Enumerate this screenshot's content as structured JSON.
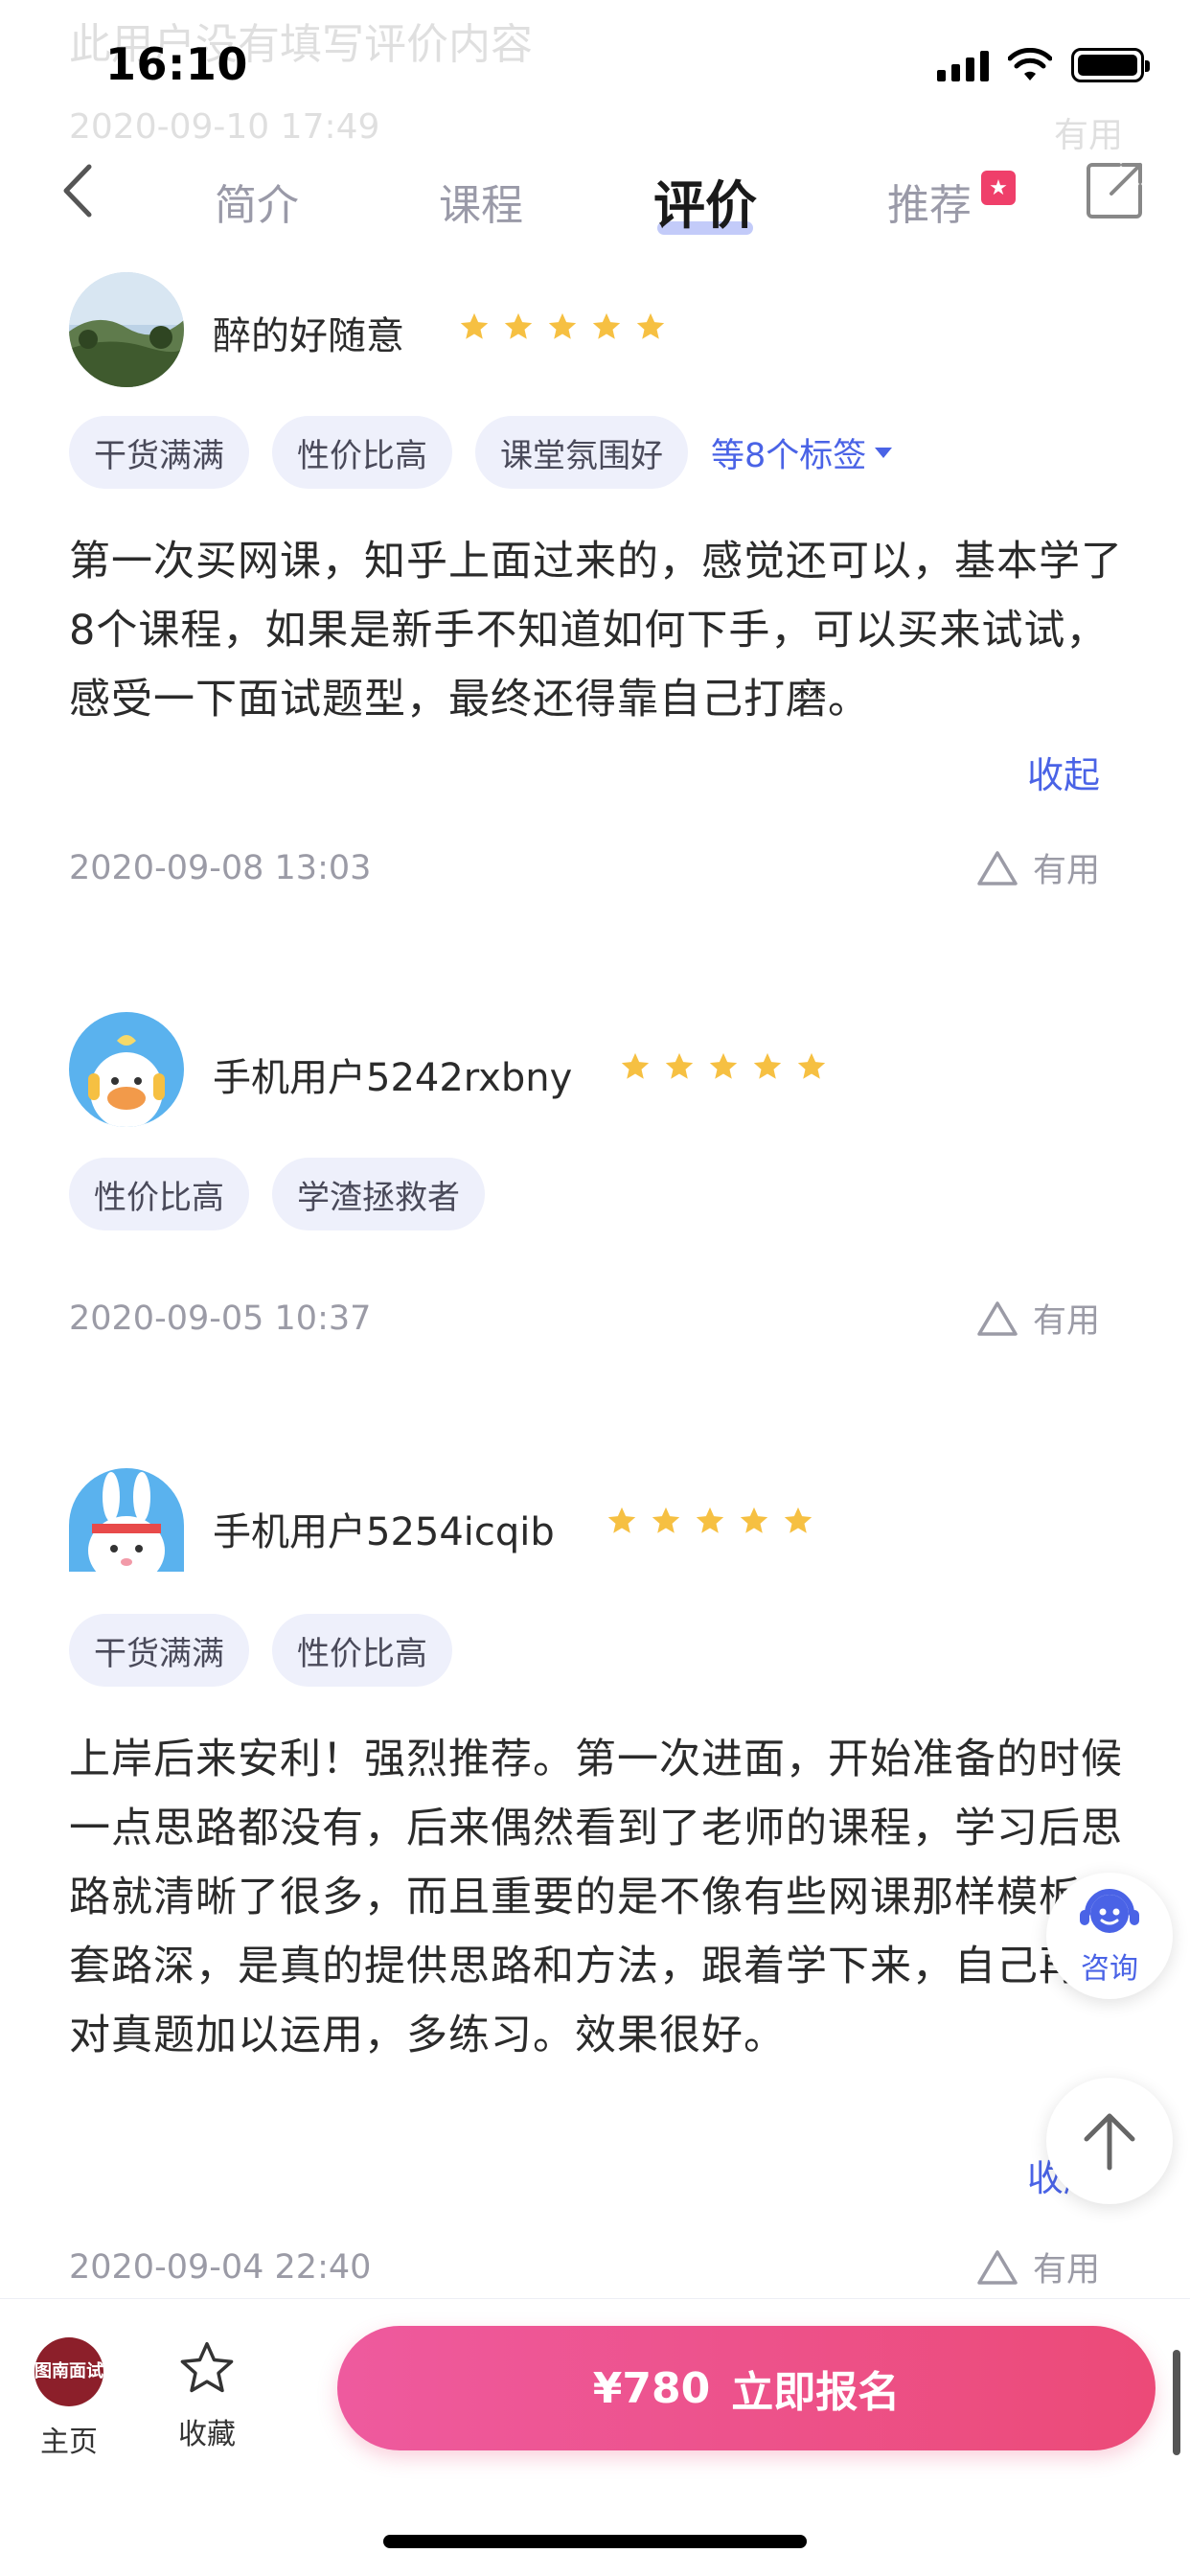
{
  "ghost": {
    "text": "此用户没有填写评价内容",
    "time": "2020-09-10 17:49",
    "useful": "有用"
  },
  "status_bar": {
    "time": "16:10"
  },
  "tabs": {
    "intro": "简介",
    "course": "课程",
    "reviews": "评价",
    "recommend": "推荐",
    "active": "评价"
  },
  "reviews": [
    {
      "username": "醉的好随意",
      "rating": 5,
      "tags": [
        "干货满满",
        "性价比高",
        "课堂氛围好"
      ],
      "more_tags": "等8个标签",
      "text": "第一次买网课，知乎上面过来的，感觉还可以，基本学了8个课程，如果是新手不知道如何下手，可以买来试试，感受一下面试题型，最终还得靠自己打磨。",
      "collapse": "收起",
      "date": "2020-09-08 13:03",
      "useful": "有用"
    },
    {
      "username": "手机用户5242rxbny",
      "rating": 5,
      "tags": [
        "性价比高",
        "学渣拯救者"
      ],
      "date": "2020-09-05 10:37",
      "useful": "有用"
    },
    {
      "username": "手机用户5254icqib",
      "rating": 5,
      "tags": [
        "干货满满",
        "性价比高"
      ],
      "text": "上岸后来安利！强烈推荐。第一次进面，开始准备的时候一点思路都没有，后来偶然看到了老师的课程，学习后思路就清晰了很多，而且重要的是不像有些网课那样模板和套路深，是真的提供思路和方法，跟着学下来，自己再针对真题加以运用，多练习。效果很好。",
      "collapse": "收起",
      "date": "2020-09-04 22:40",
      "useful": "有用"
    }
  ],
  "floating": {
    "consult": "咨询"
  },
  "bottom_bar": {
    "home_logo": "图南面试",
    "home": "主页",
    "favorite": "收藏",
    "price": "¥780",
    "cta": "立即报名"
  },
  "colors": {
    "accent": "#4a63e6",
    "tag_bg": "#eef0fb",
    "star": "#f6c042",
    "cta_start": "#ee5a9e",
    "cta_end": "#ec4a78"
  }
}
